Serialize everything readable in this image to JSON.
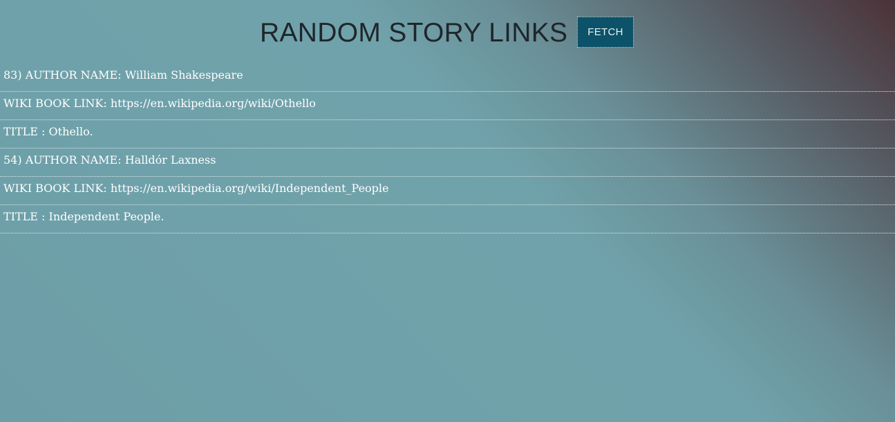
{
  "header": {
    "title": "RANDOM STORY LINKS",
    "fetch_label": "FETCH"
  },
  "results": [
    "83) AUTHOR NAME: William Shakespeare",
    "WIKI BOOK LINK: https://en.wikipedia.org/wiki/Othello",
    "TITLE : Othello.",
    "54) AUTHOR NAME: Halldór Laxness",
    "WIKI BOOK LINK: https://en.wikipedia.org/wiki/Independent_People",
    "TITLE : Independent People."
  ]
}
